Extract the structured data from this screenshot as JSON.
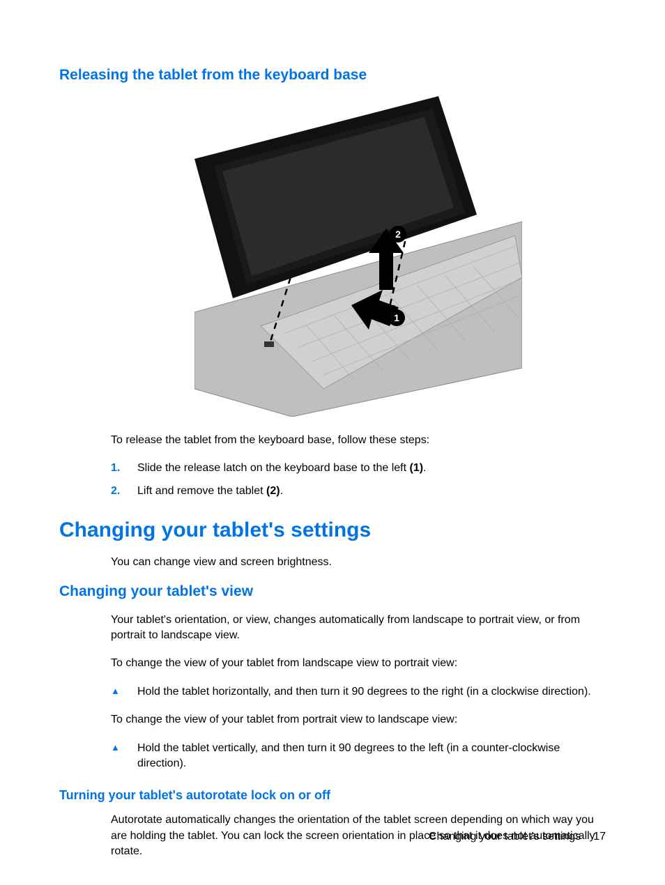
{
  "section1": {
    "heading": "Releasing the tablet from the keyboard base",
    "intro": "To release the tablet from the keyboard base, follow these steps:",
    "step1_a": "Slide the release latch on the keyboard base to the left ",
    "step1_b": "(1)",
    "step1_c": ".",
    "step2_a": "Lift and remove the tablet ",
    "step2_b": "(2)",
    "step2_c": "."
  },
  "section2": {
    "heading": "Changing your tablet's settings",
    "intro": "You can change view and screen brightness."
  },
  "section3": {
    "heading": "Changing your tablet's view",
    "p1": "Your tablet's orientation, or view, changes automatically from landscape to portrait view, or from portrait to landscape view.",
    "p2": "To change the view of your tablet from landscape view to portrait view:",
    "bullet1": "Hold the tablet horizontally, and then turn it 90 degrees to the right (in a clockwise direction).",
    "p3": "To change the view of your tablet from portrait view to landscape view:",
    "bullet2": "Hold the tablet vertically, and then turn it 90 degrees to the left (in a counter-clockwise direction)."
  },
  "section4": {
    "heading": "Turning your tablet's autorotate lock on or off",
    "p1": "Autorotate automatically changes the orientation of the tablet screen depending on which way you are holding the tablet. You can lock the screen orientation in place so that it does not automatically rotate."
  },
  "footer": {
    "label": "Changing your tablet's settings",
    "page": "17"
  }
}
